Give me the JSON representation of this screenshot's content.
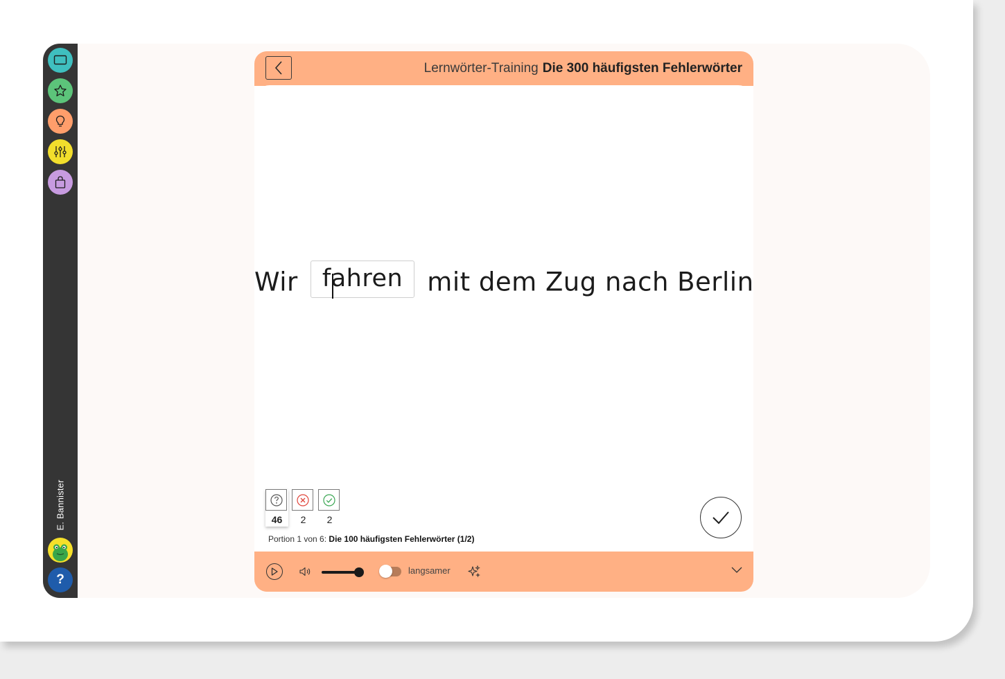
{
  "sidebar": {
    "buttons": [
      {
        "icon": "monitor-icon",
        "color": "#3fbfbf"
      },
      {
        "icon": "star-icon",
        "color": "#5cc47a"
      },
      {
        "icon": "lightbulb-icon",
        "color": "#ff9e6b"
      },
      {
        "icon": "sliders-icon",
        "color": "#f2de2c"
      },
      {
        "icon": "shopping-bag-icon",
        "color": "#c79be0"
      }
    ],
    "user_name": "E. Bannister",
    "help_label": "?"
  },
  "header": {
    "subtitle": "Lernwörter-Training",
    "title": "Die 300 häufigsten Fehlerwörter",
    "accent_color": "#ffb084"
  },
  "exercise": {
    "before": "Wir",
    "answer": "fahren",
    "after": "mit dem Zug nach Berlin."
  },
  "stats": {
    "open": "46",
    "wrong": "2",
    "correct": "2"
  },
  "portion": {
    "prefix": "Portion 1 von 6:",
    "name": "Die 100 häufigsten Fehlerwörter (1/2)"
  },
  "bottom_bar": {
    "volume_fraction": 0.9,
    "slow_enabled": false,
    "slow_label": "langsamer"
  }
}
